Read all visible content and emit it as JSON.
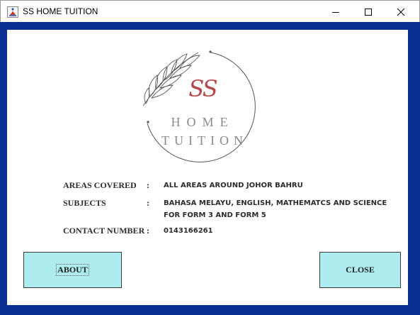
{
  "window": {
    "title": "SS HOME TUITION"
  },
  "logo": {
    "monogram": "SS",
    "line1": "HOME",
    "line2": "TUITION"
  },
  "info": {
    "areas_label": "AREAS COVERED",
    "areas_value": "ALL AREAS AROUND JOHOR BAHRU",
    "subjects_label": "SUBJECTS",
    "subjects_value_line1": "BAHASA MELAYU, ENGLISH, MATHEMATCS AND SCIENCE",
    "subjects_value_line2": "FOR FORM 3 AND FORM 5",
    "contact_label": "CONTACT NUMBER",
    "contact_value": "0143166261",
    "separator": ":"
  },
  "buttons": {
    "about_label": "ABOUT",
    "close_label": "CLOSE"
  },
  "colors": {
    "frame": "#0b2f93",
    "button_bg": "#aeedef",
    "monogram": "#b5474d"
  }
}
